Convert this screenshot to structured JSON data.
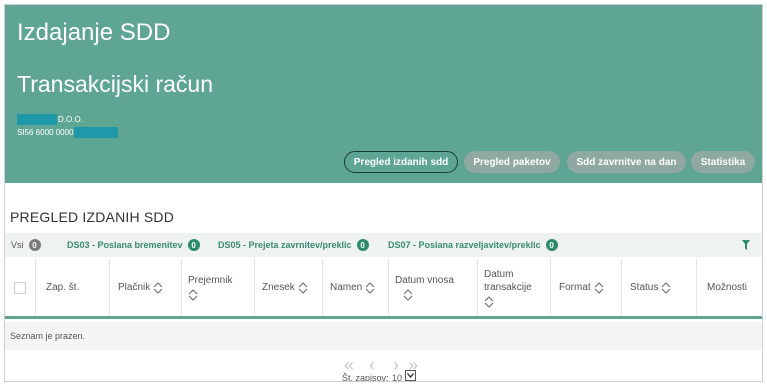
{
  "header": {
    "app_title": "Izdajanje SDD",
    "account_title": "Transakcijski račun",
    "company_suffix": "D.O.O.",
    "iban_prefix": "SI56 6000 0000",
    "buttons": [
      {
        "label": "Pregled izdanih sdd",
        "active": true
      },
      {
        "label": "Pregled paketov",
        "active": false
      },
      {
        "label": "Sdd zavrnitve na dan",
        "active": false
      },
      {
        "label": "Statistika",
        "active": false
      }
    ],
    "colors": {
      "header_bg": "#5fa594",
      "mask": "#1f98a9",
      "button_inactive": "#8fa9a2"
    }
  },
  "section": {
    "title": "PREGLED IZDANIH SDD"
  },
  "filters": {
    "items": [
      {
        "label": "Vsi",
        "count": "0"
      },
      {
        "label": "DS03 - Poslana bremenitev",
        "count": "0"
      },
      {
        "label": "DS05 - Prejeta zavrnitev/preklic",
        "count": "0"
      },
      {
        "label": "DS07 - Poslana razveljavitev/preklic",
        "count": "0"
      }
    ],
    "icon": "filter-icon"
  },
  "table": {
    "columns": [
      {
        "label": "Zap. št.",
        "sortable": false
      },
      {
        "label": "Plačnik",
        "sortable": true
      },
      {
        "label": "Prejemnik",
        "sortable": true
      },
      {
        "label": "Znesek",
        "sortable": true
      },
      {
        "label": "Namen",
        "sortable": true
      },
      {
        "label": "Datum vnosa",
        "sortable": true
      },
      {
        "label": "Datum transakcije",
        "sortable": true
      },
      {
        "label": "Format",
        "sortable": true
      },
      {
        "label": "Status",
        "sortable": true
      },
      {
        "label": "Možnosti",
        "sortable": false
      }
    ],
    "empty_text": "Seznam je prazen."
  },
  "pager": {
    "label": "Št. zapisov:",
    "page_size": "10"
  }
}
